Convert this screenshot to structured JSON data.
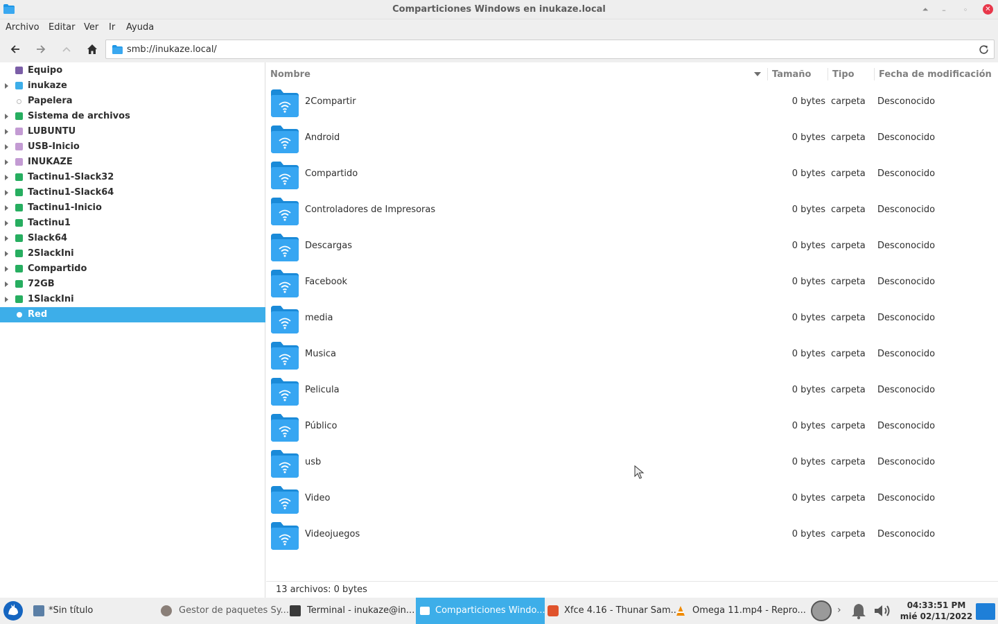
{
  "window": {
    "title": "Comparticiones Windows en inukaze.local"
  },
  "menu": [
    "Archivo",
    "Editar",
    "Ver",
    "Ir",
    "Ayuda"
  ],
  "location": {
    "path": "smb://inukaze.local/"
  },
  "sidebar": {
    "items": [
      {
        "label": "Equipo",
        "expandable": false,
        "icon": "computer-icon",
        "color": "#7b5ea7"
      },
      {
        "label": "inukaze",
        "expandable": true,
        "icon": "home-icon",
        "color": "#3daee9"
      },
      {
        "label": "Papelera",
        "expandable": false,
        "icon": "trash-icon",
        "color": "#bbbbbb"
      },
      {
        "label": "Sistema de archivos",
        "expandable": true,
        "icon": "drive-icon",
        "color": "#27ae60"
      },
      {
        "label": "LUBUNTU",
        "expandable": true,
        "icon": "usb-drive-icon",
        "color": "#c39bd3"
      },
      {
        "label": "USB-Inicio",
        "expandable": true,
        "icon": "usb-drive-icon",
        "color": "#c39bd3"
      },
      {
        "label": "INUKAZE",
        "expandable": true,
        "icon": "usb-drive-icon",
        "color": "#c39bd3"
      },
      {
        "label": "Tactinu1-Slack32",
        "expandable": true,
        "icon": "drive-icon",
        "color": "#27ae60"
      },
      {
        "label": "Tactinu1-Slack64",
        "expandable": true,
        "icon": "drive-icon",
        "color": "#27ae60"
      },
      {
        "label": "Tactinu1-Inicio",
        "expandable": true,
        "icon": "drive-icon",
        "color": "#27ae60"
      },
      {
        "label": "Tactinu1",
        "expandable": true,
        "icon": "drive-icon",
        "color": "#27ae60"
      },
      {
        "label": "Slack64",
        "expandable": true,
        "icon": "drive-icon",
        "color": "#27ae60"
      },
      {
        "label": "2SlackIni",
        "expandable": true,
        "icon": "drive-icon",
        "color": "#27ae60"
      },
      {
        "label": "Compartido",
        "expandable": true,
        "icon": "drive-icon",
        "color": "#27ae60"
      },
      {
        "label": "72GB",
        "expandable": true,
        "icon": "drive-icon",
        "color": "#27ae60"
      },
      {
        "label": "1SlackIni",
        "expandable": true,
        "icon": "drive-icon",
        "color": "#27ae60"
      },
      {
        "label": "Red",
        "expandable": false,
        "icon": "network-icon",
        "color": "#ffffff",
        "selected": true
      }
    ]
  },
  "columns": {
    "name": "Nombre",
    "size": "Tamaño",
    "type": "Tipo",
    "date": "Fecha de modificación"
  },
  "files": [
    {
      "name": "2Compartir",
      "size": "0 bytes",
      "type": "carpeta",
      "date": "Desconocido"
    },
    {
      "name": "Android",
      "size": "0 bytes",
      "type": "carpeta",
      "date": "Desconocido"
    },
    {
      "name": "Compartido",
      "size": "0 bytes",
      "type": "carpeta",
      "date": "Desconocido"
    },
    {
      "name": "Controladores de Impresoras",
      "size": "0 bytes",
      "type": "carpeta",
      "date": "Desconocido"
    },
    {
      "name": "Descargas",
      "size": "0 bytes",
      "type": "carpeta",
      "date": "Desconocido"
    },
    {
      "name": "Facebook",
      "size": "0 bytes",
      "type": "carpeta",
      "date": "Desconocido"
    },
    {
      "name": "media",
      "size": "0 bytes",
      "type": "carpeta",
      "date": "Desconocido"
    },
    {
      "name": "Musica",
      "size": "0 bytes",
      "type": "carpeta",
      "date": "Desconocido"
    },
    {
      "name": "Pelicula",
      "size": "0 bytes",
      "type": "carpeta",
      "date": "Desconocido"
    },
    {
      "name": "Público",
      "size": "0 bytes",
      "type": "carpeta",
      "date": "Desconocido"
    },
    {
      "name": "usb",
      "size": "0 bytes",
      "type": "carpeta",
      "date": "Desconocido"
    },
    {
      "name": "Video",
      "size": "0 bytes",
      "type": "carpeta",
      "date": "Desconocido"
    },
    {
      "name": "Videojuegos",
      "size": "0 bytes",
      "type": "carpeta",
      "date": "Desconocido"
    }
  ],
  "status": "13 archivos: 0 bytes",
  "taskbar": {
    "tasks": [
      {
        "label": "*Sin título",
        "icon": "text-editor-icon"
      },
      {
        "label": "Gestor de paquetes Sy...",
        "icon": "package-manager-icon",
        "dim": true
      },
      {
        "label": "Terminal - inukaze@in...",
        "icon": "terminal-icon"
      },
      {
        "label": "Comparticiones Windo...",
        "icon": "folder-icon",
        "active": true
      },
      {
        "label": "Xfce 4.16 - Thunar Sam...",
        "icon": "brave-browser-icon"
      },
      {
        "label": "Omega 11.mp4 - Repro...",
        "icon": "vlc-icon"
      }
    ],
    "time": "04:33:51 PM",
    "date": "mié 02/11/2022"
  },
  "colors": {
    "accent": "#3daee9",
    "folder": "#1e96e6",
    "close": "#e8374a"
  }
}
